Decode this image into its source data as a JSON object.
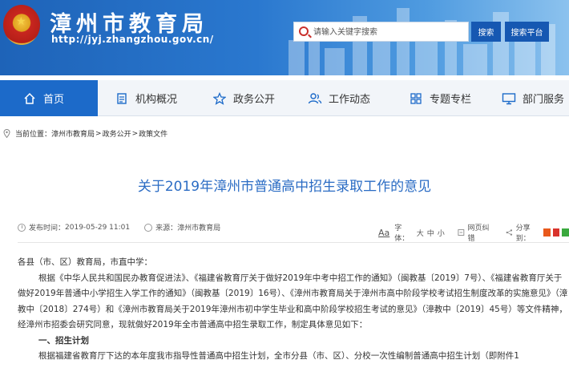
{
  "header": {
    "site_title": "漳州市教育局",
    "site_url": "http://jyj.zhangzhou.gov.cn/",
    "search_placeholder": "请输入关键字搜索",
    "search_button": "搜索",
    "platform_button": "搜索平台"
  },
  "nav": {
    "items": [
      {
        "label": "首页",
        "icon": "home-icon"
      },
      {
        "label": "机构概况",
        "icon": "document-icon"
      },
      {
        "label": "政务公开",
        "icon": "star-icon"
      },
      {
        "label": "工作动态",
        "icon": "users-icon"
      },
      {
        "label": "专题专栏",
        "icon": "grid-icon"
      },
      {
        "label": "部门服务",
        "icon": "monitor-icon"
      }
    ]
  },
  "breadcrumb": {
    "prefix": "当前位置：",
    "items": [
      "漳州市教育局",
      "政务公开",
      "政策文件"
    ],
    "separator": ">"
  },
  "article": {
    "title": "关于2019年漳州市普通高中招生录取工作的意见",
    "publish_label": "发布时间：",
    "publish_time": "2019-05-29 11:01",
    "source_label": "来源：",
    "source": "漳州市教育局",
    "font_label": "字体：",
    "font_sizes": [
      "大",
      "中",
      "小"
    ],
    "error_label": "网页纠错",
    "share_label": "分享到：",
    "greeting": "各县（市、区）教育局，市直中学：",
    "paragraph_1": "根据《中华人民共和国民办教育促进法》、《福建省教育厅关于做好2019年中考中招工作的通知》（闽教基〔2019〕7号）、《福建省教育厅关于做好2019年普通中小学招生入学工作的通知》（闽教基〔2019〕16号）、《漳州市教育局关于漳州市高中阶段学校考试招生制度改革的实施意见》（漳教中〔2018〕274号）和《漳州市教育局关于2019年漳州市初中学生毕业和高中阶段学校招生考试的意见》（漳教中〔2019〕45号）等文件精神，经漳州市招委会研究同意，现就做好2019年全市普通高中招生录取工作，制定具体意见如下：",
    "section_1": "一、招生计划",
    "paragraph_2": "根据福建省教育厅下达的本年度我市指导性普通高中招生计划，全市分县（市、区）、分校一次性编制普通高中招生计划（即附件1"
  },
  "colors": {
    "banner": "#1e63b8",
    "nav_active": "#1c6ac9",
    "title": "#2b6cc4",
    "button": "#1658b2"
  }
}
